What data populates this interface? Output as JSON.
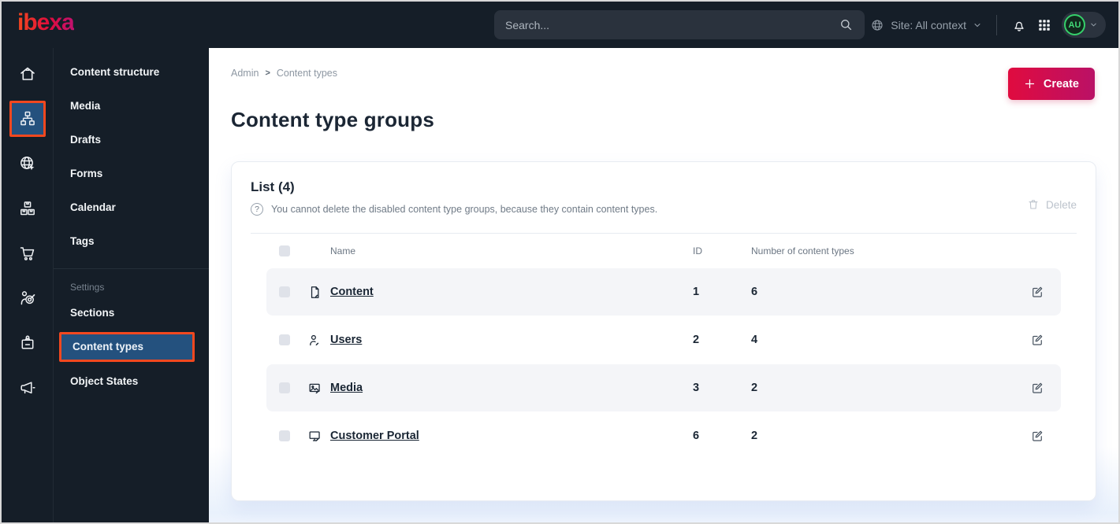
{
  "topbar": {
    "logo": "ibexa",
    "search_placeholder": "Search...",
    "site_context": "Site: All context",
    "avatar_initials": "AU"
  },
  "rail_icons": [
    "home-icon",
    "content-tree-icon",
    "globe-pointer-icon",
    "packages-icon",
    "cart-icon",
    "personalization-target-icon",
    "badge-icon",
    "megaphone-icon"
  ],
  "sidebar": {
    "items": [
      "Content structure",
      "Media",
      "Drafts",
      "Forms",
      "Calendar",
      "Tags"
    ],
    "settings_header": "Settings",
    "settings_items": [
      "Sections",
      "Content types",
      "Object States"
    ],
    "active_item": "Content types"
  },
  "main": {
    "breadcrumb": {
      "items": [
        "Admin",
        "Content types"
      ],
      "separator": ">"
    },
    "create_label": "Create",
    "page_title": "Content type groups",
    "panel": {
      "title": "List (4)",
      "delete_label": "Delete",
      "help_glyph": "?",
      "hint": "You cannot delete the disabled content type groups, because they contain content types.",
      "table": {
        "columns": [
          "Name",
          "ID",
          "Number of content types"
        ],
        "rows": [
          {
            "icon": "file-edit-icon",
            "name": "Content",
            "id": "1",
            "count": "6"
          },
          {
            "icon": "user-edit-icon",
            "name": "Users",
            "id": "2",
            "count": "4"
          },
          {
            "icon": "image-edit-icon",
            "name": "Media",
            "id": "3",
            "count": "2"
          },
          {
            "icon": "screen-edit-icon",
            "name": "Customer Portal",
            "id": "6",
            "count": "2"
          }
        ]
      }
    }
  },
  "colors": {
    "topbar_bg": "#151e28",
    "active_blue": "#24517e",
    "highlight_orange": "#f2481f",
    "create_gradient_start": "#e00b3f",
    "create_gradient_end": "#ba1166",
    "row_alt_bg": "#f4f5f8",
    "avatar_green": "#35d06a",
    "text_dark": "#1b2634"
  }
}
